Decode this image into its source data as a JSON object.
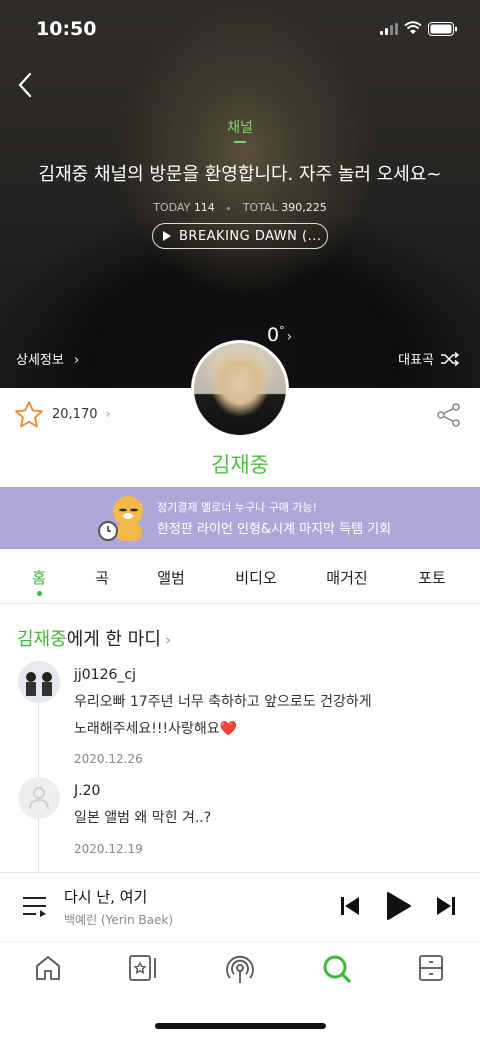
{
  "status_bar": {
    "time": "10:50"
  },
  "hero": {
    "channel_label": "채널",
    "welcome_text": "김재중 채널의 방문을 환영합니다. 자주 놀러 오세요~",
    "today_label": "TODAY",
    "today_value": "114",
    "total_label": "TOTAL",
    "total_value": "390,225",
    "song_pill": "BREAKING DAWN (...",
    "degree_value": "0",
    "degree_unit": "°",
    "detail_label": "상세정보",
    "rep_song_label": "대표곡"
  },
  "profile": {
    "fan_count": "20,170",
    "artist_name": "김재중"
  },
  "banner": {
    "line1": "정기결제 멜로너 누구나 구매 가능!",
    "line2": "한정판 라이언 인형&시계 마지막 득템 기회"
  },
  "tabs": [
    {
      "label": "홈",
      "active": true
    },
    {
      "label": "곡"
    },
    {
      "label": "앨범"
    },
    {
      "label": "비디오"
    },
    {
      "label": "매거진"
    },
    {
      "label": "포토"
    }
  ],
  "comments_section": {
    "title_artist": "김재중",
    "title_suffix": "에게 한 마디",
    "comments": [
      {
        "user": "jj0126_cj",
        "line1": "우리오빠 17주년 너무 축하하고 앞으로도 건강하게",
        "line2": "노래해주세요!!!사랑해요❤️",
        "date": "2020.12.26"
      },
      {
        "user": "J.20",
        "line1": "일본 앨범 왜 막힌 겨..?",
        "date": "2020.12.19"
      }
    ]
  },
  "player": {
    "title": "다시 난, 여기",
    "artist": "백예린 (Yerin Baek)"
  },
  "colors": {
    "accent_green": "#3fb73a",
    "banner_purple": "#b0a6d8"
  }
}
